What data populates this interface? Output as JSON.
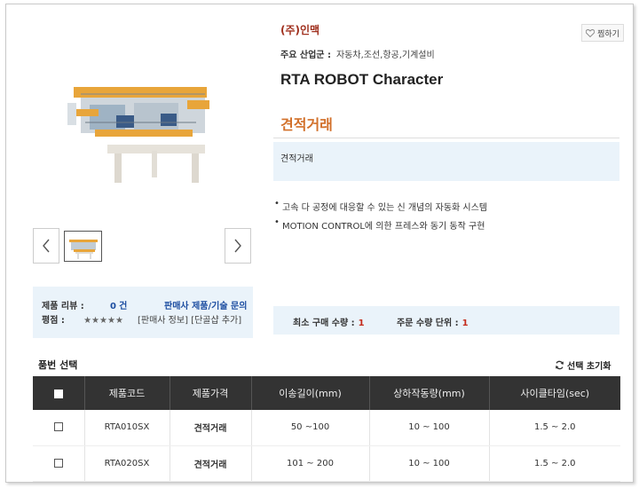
{
  "product": {
    "company": "(주)인맥",
    "industry_label": "주요 산업군 :",
    "industry_value": "자동차,조선,항공,기계설비",
    "title": "RTA ROBOT Character",
    "price_label": "견적거래",
    "price_note": "견적거래",
    "features": [
      "고속 다 공정에 대응할 수 있는 신 개념의 자동화 시스템",
      "MOTION CONTROL에 의한 프레스와 동기 동작 구현"
    ],
    "wish_label": "찜하기",
    "wish_icon": "heart-icon"
  },
  "gallery": {
    "prev_icon": "chevron-left-icon",
    "next_icon": "chevron-right-icon"
  },
  "review": {
    "review_label": "제품 리뷰 :",
    "review_count": "0",
    "review_unit": "건",
    "rating_label": "평점 :",
    "rating_stars": "★★★★★",
    "inquiry_link": "판매사 제품/기술 문의",
    "seller_info_link": "[판매사 정보]",
    "add_favorite_link": "[단골샵 추가]"
  },
  "purchase": {
    "min_qty_label": "최소 구매 수량 :",
    "min_qty_value": "1",
    "order_unit_label": "주문 수량 단위 :",
    "order_unit_value": "1"
  },
  "options": {
    "section_title": "품번 선택",
    "reset_label": "선택 초기화",
    "reset_icon": "refresh-icon",
    "headers": [
      "제품코드",
      "제품가격",
      "이송길이(mm)",
      "상하작동량(mm)",
      "사이클타임(sec)"
    ],
    "rows": [
      {
        "code": "RTA010SX",
        "price": "견적거래",
        "transfer": "50 ~100",
        "stroke": "10 ~ 100",
        "cycle": "1.5 ~ 2.0"
      },
      {
        "code": "RTA020SX",
        "price": "견적거래",
        "transfer": "101 ~ 200",
        "stroke": "10 ~ 100",
        "cycle": "1.5 ~ 2.0"
      }
    ]
  },
  "colors": {
    "accent_orange": "#d2702a",
    "company_red": "#a0301e",
    "link_blue": "#1d4ea1",
    "light_blue_bg": "#eaf3fa",
    "table_header_bg": "#333333"
  }
}
